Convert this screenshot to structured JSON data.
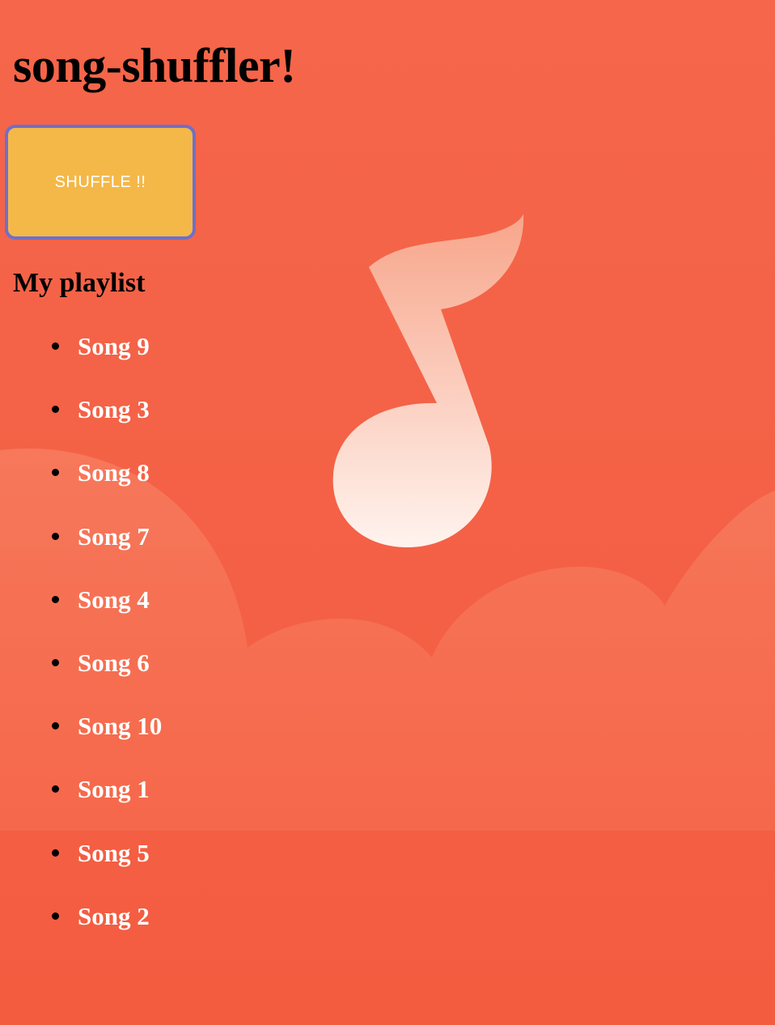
{
  "app": {
    "title": "song-shuffler!"
  },
  "controls": {
    "shuffle_label": "SHUFFLE !!"
  },
  "playlist": {
    "heading": "My playlist",
    "songs": [
      "Song 9",
      "Song 3",
      "Song 8",
      "Song 7",
      "Song 4",
      "Song 6",
      "Song 10",
      "Song 1",
      "Song 5",
      "Song 2"
    ]
  },
  "background": {
    "icon": "music-note-icon",
    "decoration": "cloud-shapes"
  },
  "colors": {
    "background": "#f5634a",
    "button": "#f4b848",
    "button_focus_ring": "#6f6fc9",
    "song_text": "#ffffff",
    "heading_text": "#000000"
  }
}
